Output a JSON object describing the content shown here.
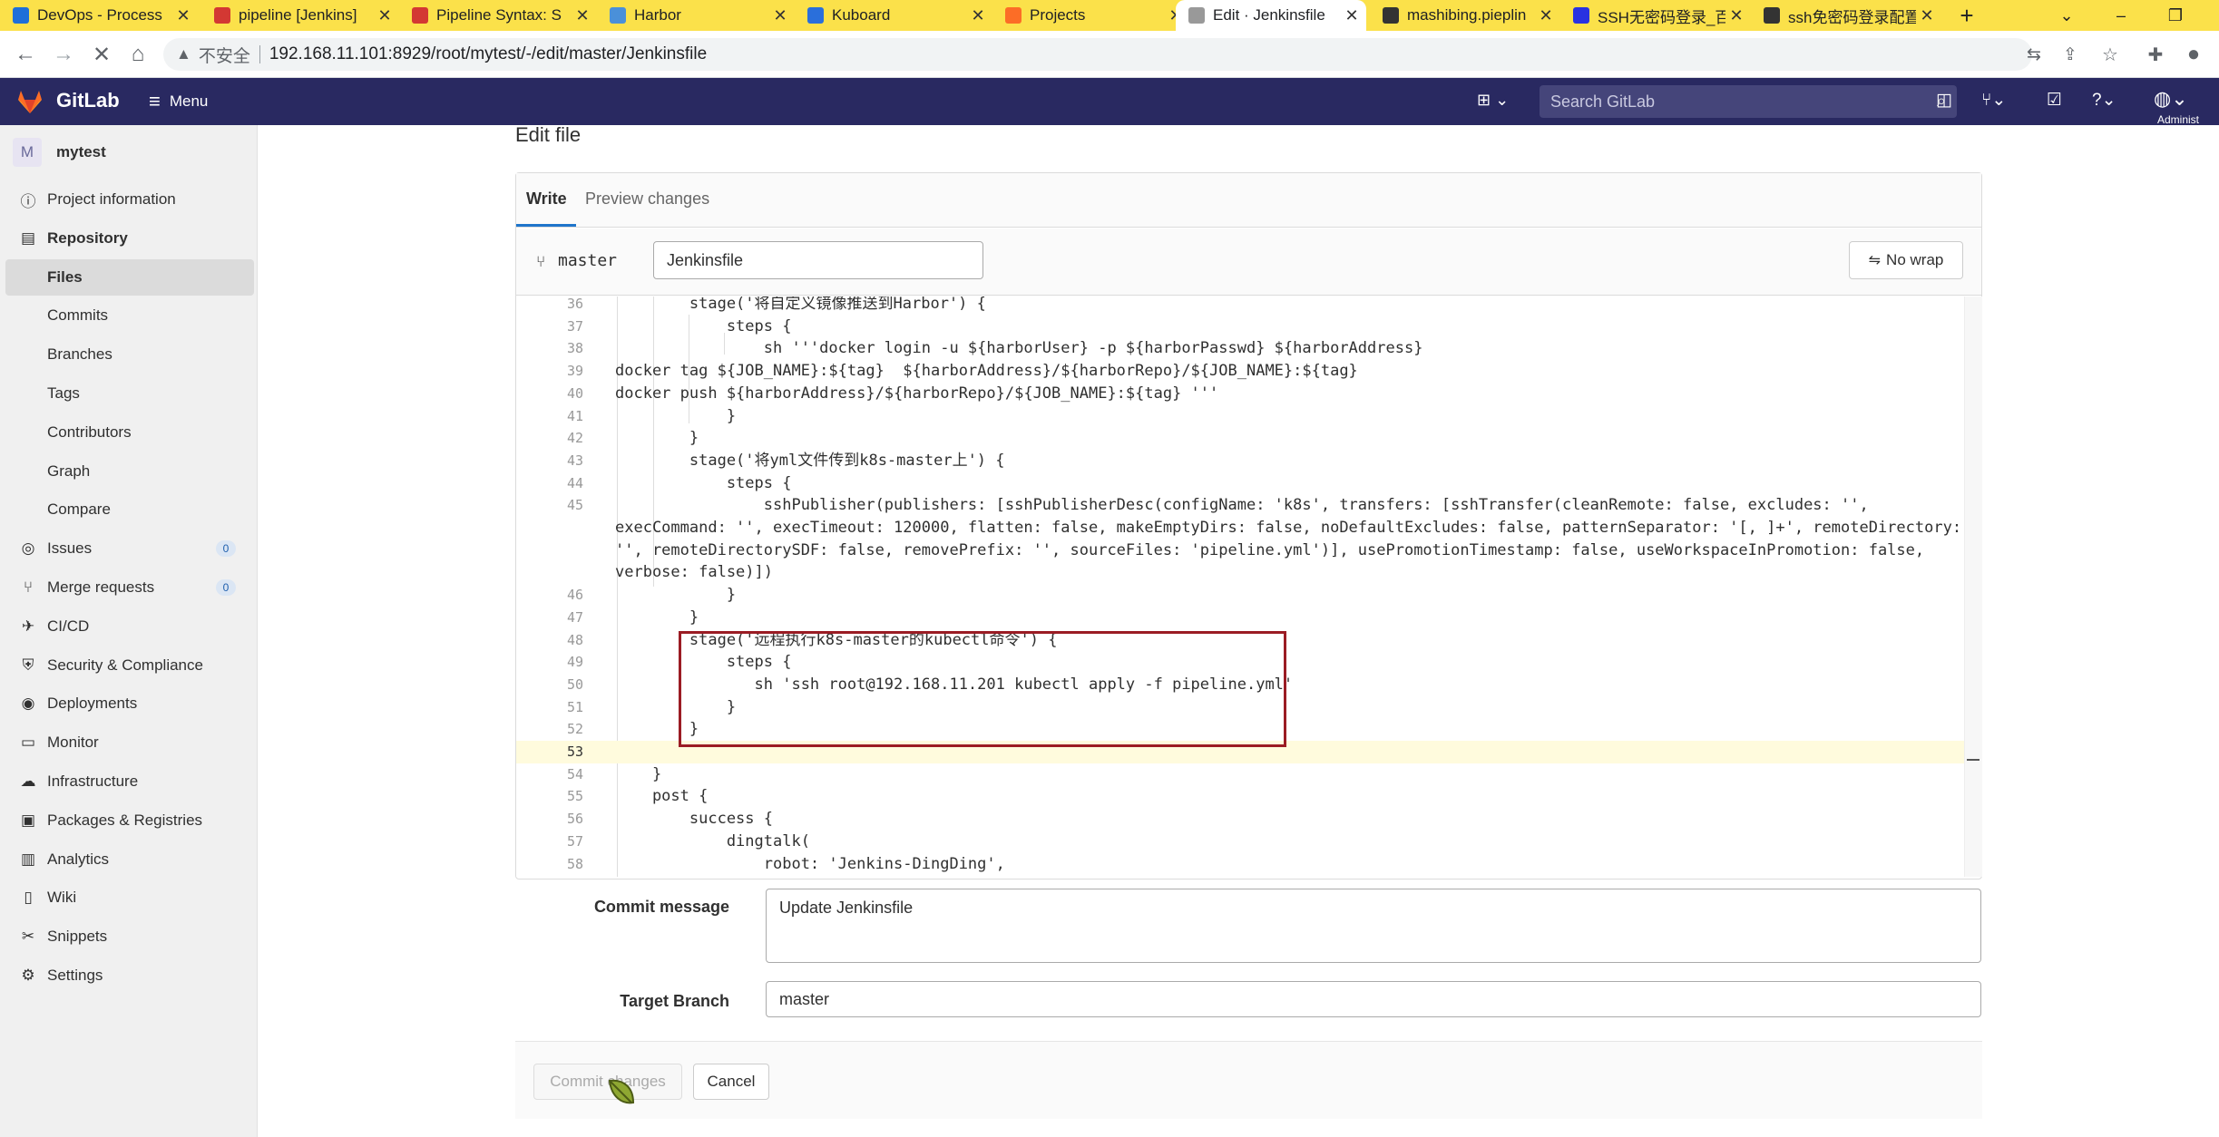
{
  "browser": {
    "tabs": [
      {
        "title": "DevOps - Process",
        "favicon": "on-badge-icon",
        "color": "#1e6fd9",
        "active": false
      },
      {
        "title": "pipeline [Jenkins]",
        "favicon": "jenkins-icon",
        "color": "#d33833",
        "active": false
      },
      {
        "title": "Pipeline Syntax: S",
        "favicon": "jenkins-icon",
        "color": "#d33833",
        "active": false
      },
      {
        "title": "Harbor",
        "favicon": "harbor-icon",
        "color": "#4a90d9",
        "active": false
      },
      {
        "title": "Kuboard",
        "favicon": "kuboard-icon",
        "color": "#2a6fdb",
        "active": false
      },
      {
        "title": "Projects",
        "favicon": "gitlab-icon",
        "color": "#fc6d26",
        "active": false
      },
      {
        "title": "Edit · Jenkinsfile",
        "favicon": "loading-icon",
        "color": "#999999",
        "active": true
      },
      {
        "title": "mashibing.pieplin",
        "favicon": "github-icon",
        "color": "#333333",
        "active": false
      },
      {
        "title": "SSH无密码登录_百",
        "favicon": "baidu-icon",
        "color": "#2932e1",
        "active": false
      },
      {
        "title": "ssh免密码登录配置",
        "favicon": "github-icon",
        "color": "#333333",
        "active": false
      }
    ],
    "new_tab": "+",
    "insecure_label": "不安全",
    "url": "192.168.11.101:8929/root/mytest/-/edit/master/Jenkinsfile"
  },
  "gitlab": {
    "brand": "GitLab",
    "menu_label": "Menu",
    "search_placeholder": "Search GitLab",
    "admin_label": "Administ"
  },
  "sidebar": {
    "project_initial": "M",
    "project_name": "mytest",
    "items": [
      {
        "label": "Project information",
        "icon": "info-icon",
        "glyph": "ⓘ",
        "level": "top"
      },
      {
        "label": "Repository",
        "icon": "book-icon",
        "glyph": "▤",
        "level": "top",
        "bold": true
      },
      {
        "label": "Files",
        "level": "sub",
        "active": true
      },
      {
        "label": "Commits",
        "level": "sub"
      },
      {
        "label": "Branches",
        "level": "sub"
      },
      {
        "label": "Tags",
        "level": "sub"
      },
      {
        "label": "Contributors",
        "level": "sub"
      },
      {
        "label": "Graph",
        "level": "sub"
      },
      {
        "label": "Compare",
        "level": "sub"
      },
      {
        "label": "Issues",
        "icon": "issues-icon",
        "glyph": "◎",
        "level": "top",
        "badge": "0"
      },
      {
        "label": "Merge requests",
        "icon": "merge-request-icon",
        "glyph": "⑂",
        "level": "top",
        "badge": "0"
      },
      {
        "label": "CI/CD",
        "icon": "rocket-icon",
        "glyph": "✈",
        "level": "top"
      },
      {
        "label": "Security & Compliance",
        "icon": "shield-icon",
        "glyph": "⛨",
        "level": "top"
      },
      {
        "label": "Deployments",
        "icon": "deployments-icon",
        "glyph": "◉",
        "level": "top"
      },
      {
        "label": "Monitor",
        "icon": "monitor-icon",
        "glyph": "▭",
        "level": "top"
      },
      {
        "label": "Infrastructure",
        "icon": "cloud-icon",
        "glyph": "☁",
        "level": "top"
      },
      {
        "label": "Packages & Registries",
        "icon": "package-icon",
        "glyph": "▣",
        "level": "top"
      },
      {
        "label": "Analytics",
        "icon": "chart-icon",
        "glyph": "▥",
        "level": "top"
      },
      {
        "label": "Wiki",
        "icon": "wiki-icon",
        "glyph": "▯",
        "level": "top"
      },
      {
        "label": "Snippets",
        "icon": "scissors-icon",
        "glyph": "✂",
        "level": "top"
      },
      {
        "label": "Settings",
        "icon": "gear-icon",
        "glyph": "⚙",
        "level": "top"
      }
    ]
  },
  "main": {
    "page_title": "Edit file",
    "tab_write": "Write",
    "tab_preview": "Preview changes",
    "branch": "master",
    "filename": "Jenkinsfile",
    "nowrap_label": "No wrap",
    "code_lines": [
      {
        "n": "36",
        "t": "        stage('将自定义镜像推送到Harbor') {"
      },
      {
        "n": "37",
        "t": "            steps {"
      },
      {
        "n": "38",
        "t": "                sh '''docker login -u ${harborUser} -p ${harborPasswd} ${harborAddress}"
      },
      {
        "n": "39",
        "t": "docker tag ${JOB_NAME}:${tag}  ${harborAddress}/${harborRepo}/${JOB_NAME}:${tag}"
      },
      {
        "n": "40",
        "t": "docker push ${harborAddress}/${harborRepo}/${JOB_NAME}:${tag} '''"
      },
      {
        "n": "41",
        "t": "            }"
      },
      {
        "n": "42",
        "t": "        }"
      },
      {
        "n": "43",
        "t": "        stage('将yml文件传到k8s-master上') {"
      },
      {
        "n": "44",
        "t": "            steps {"
      },
      {
        "n": "45",
        "t": "                sshPublisher(publishers: [sshPublisherDesc(configName: 'k8s', transfers: [sshTransfer(cleanRemote: false, excludes: '',"
      },
      {
        "n": "",
        "t": "execCommand: '', execTimeout: 120000, flatten: false, makeEmptyDirs: false, noDefaultExcludes: false, patternSeparator: '[, ]+', remoteDirectory:"
      },
      {
        "n": "",
        "t": "'', remoteDirectorySDF: false, removePrefix: '', sourceFiles: 'pipeline.yml')], usePromotionTimestamp: false, useWorkspaceInPromotion: false,"
      },
      {
        "n": "",
        "t": "verbose: false)])"
      },
      {
        "n": "46",
        "t": "            }"
      },
      {
        "n": "47",
        "t": "        }"
      },
      {
        "n": "48",
        "t": "        stage('远程执行k8s-master的kubectl命令') {"
      },
      {
        "n": "49",
        "t": "            steps {"
      },
      {
        "n": "50",
        "t": "               sh 'ssh root@192.168.11.201 kubectl apply -f pipeline.yml'"
      },
      {
        "n": "51",
        "t": "            }"
      },
      {
        "n": "52",
        "t": "        }"
      },
      {
        "n": "53",
        "t": "",
        "current": true
      },
      {
        "n": "54",
        "t": "    }"
      },
      {
        "n": "55",
        "t": "    post {"
      },
      {
        "n": "56",
        "t": "        success {"
      },
      {
        "n": "57",
        "t": "            dingtalk("
      },
      {
        "n": "58",
        "t": "                robot: 'Jenkins-DingDing',"
      }
    ],
    "commit_message_label": "Commit message",
    "commit_message": "Update Jenkinsfile",
    "target_branch_label": "Target Branch",
    "target_branch": "master",
    "commit_button": "Commit changes",
    "cancel_button": "Cancel"
  }
}
